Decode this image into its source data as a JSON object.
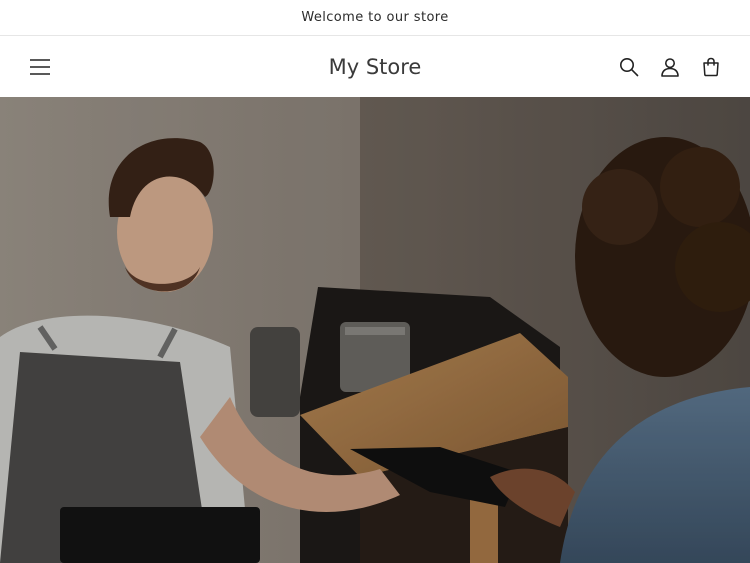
{
  "announcement": {
    "text": "Welcome to our store"
  },
  "header": {
    "store_name": "My Store",
    "icons": [
      "menu-icon",
      "search-icon",
      "account-icon",
      "cart-icon"
    ]
  },
  "hero": {
    "image": "photo of a barista handing a card reader to a customer across a café counter"
  },
  "colors": {
    "text": "#121212",
    "border": "#e6e6e6",
    "background": "#ffffff"
  }
}
